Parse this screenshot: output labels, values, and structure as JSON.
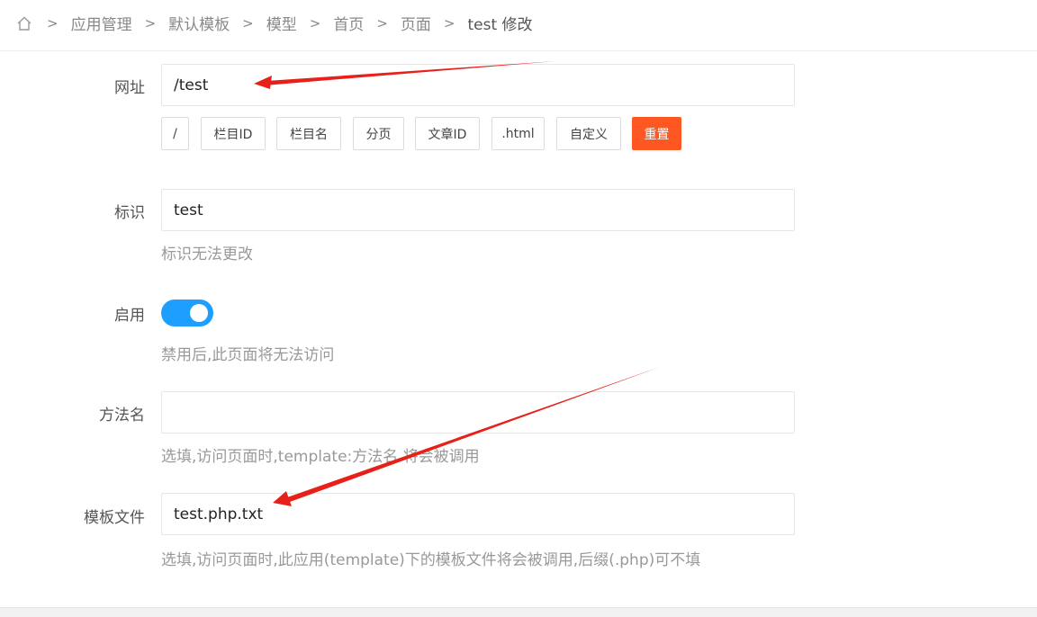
{
  "breadcrumb": {
    "home_icon": "home-icon",
    "separator": ">",
    "items": [
      "应用管理",
      "默认模板",
      "模型",
      "首页",
      "页面"
    ],
    "current": "test 修改"
  },
  "form": {
    "url": {
      "label": "网址",
      "value": "/test",
      "buttons": [
        "/",
        "栏目ID",
        "栏目名",
        "分页",
        "文章ID",
        ".html",
        "自定义"
      ],
      "reset_label": "重置"
    },
    "identifier": {
      "label": "标识",
      "value": "test",
      "help": "标识无法更改"
    },
    "enabled": {
      "label": "启用",
      "on": true,
      "help": "禁用后,此页面将无法访问"
    },
    "method": {
      "label": "方法名",
      "value": "",
      "help": "选填,访问页面时,template:方法名 将会被调用"
    },
    "template_file": {
      "label": "模板文件",
      "value": "test.php.txt",
      "help": "选填,访问页面时,此应用(template)下的模板文件将会被调用,后缀(.php)可不填"
    }
  },
  "colors": {
    "accent": "#1e9fff",
    "reset": "#ff5722",
    "annotation_arrow": "#e8201a"
  }
}
